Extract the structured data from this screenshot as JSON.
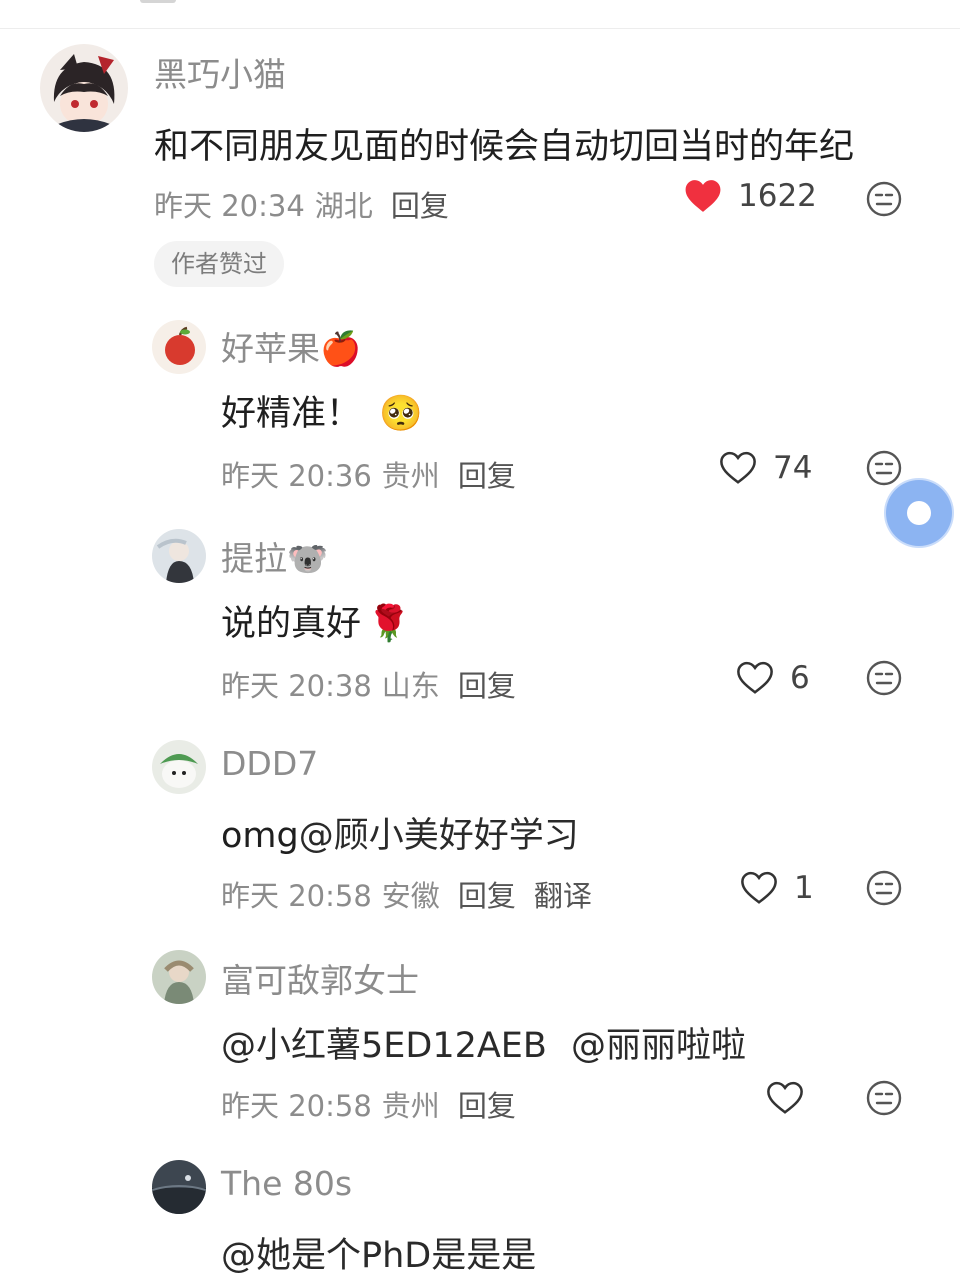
{
  "colors": {
    "like_active": "#f0303f",
    "meta_gray": "#8c8c8c",
    "bubble_blue": "#8cb4f2"
  },
  "top_comment": {
    "author": "黑巧小猫",
    "text": "和不同朋友见面的时候会自动切回当时的年纪",
    "time": "昨天 20:34",
    "location": "湖北",
    "reply": "回复",
    "likes": "1622",
    "liked": true,
    "badge": "作者赞过",
    "emoji_icon": "neutral-face-icon"
  },
  "replies": [
    {
      "author": "好苹果🍎",
      "text": "好精准！",
      "emoji": "🥺",
      "time": "昨天 20:36",
      "location": "贵州",
      "reply": "回复",
      "likes": "74"
    },
    {
      "author": "提拉🐨",
      "text": "说的真好",
      "emoji": "🌹",
      "time": "昨天 20:38",
      "location": "山东",
      "reply": "回复",
      "likes": "6"
    },
    {
      "author": "DDD7",
      "text_plain": "omg",
      "mention": "@顾小美好好学习",
      "time": "昨天 20:58",
      "location": "安徽",
      "reply": "回复",
      "translate": "翻译",
      "likes": "1"
    },
    {
      "author": "富可敌郭女士",
      "mention": "@小红薯5ED12AEB",
      "mention2": "@丽丽啦啦",
      "time": "昨天 20:58",
      "location": "贵州",
      "reply": "回复",
      "likes": ""
    },
    {
      "author": "The 80s",
      "mention": "@她是个PhD是是是"
    }
  ]
}
